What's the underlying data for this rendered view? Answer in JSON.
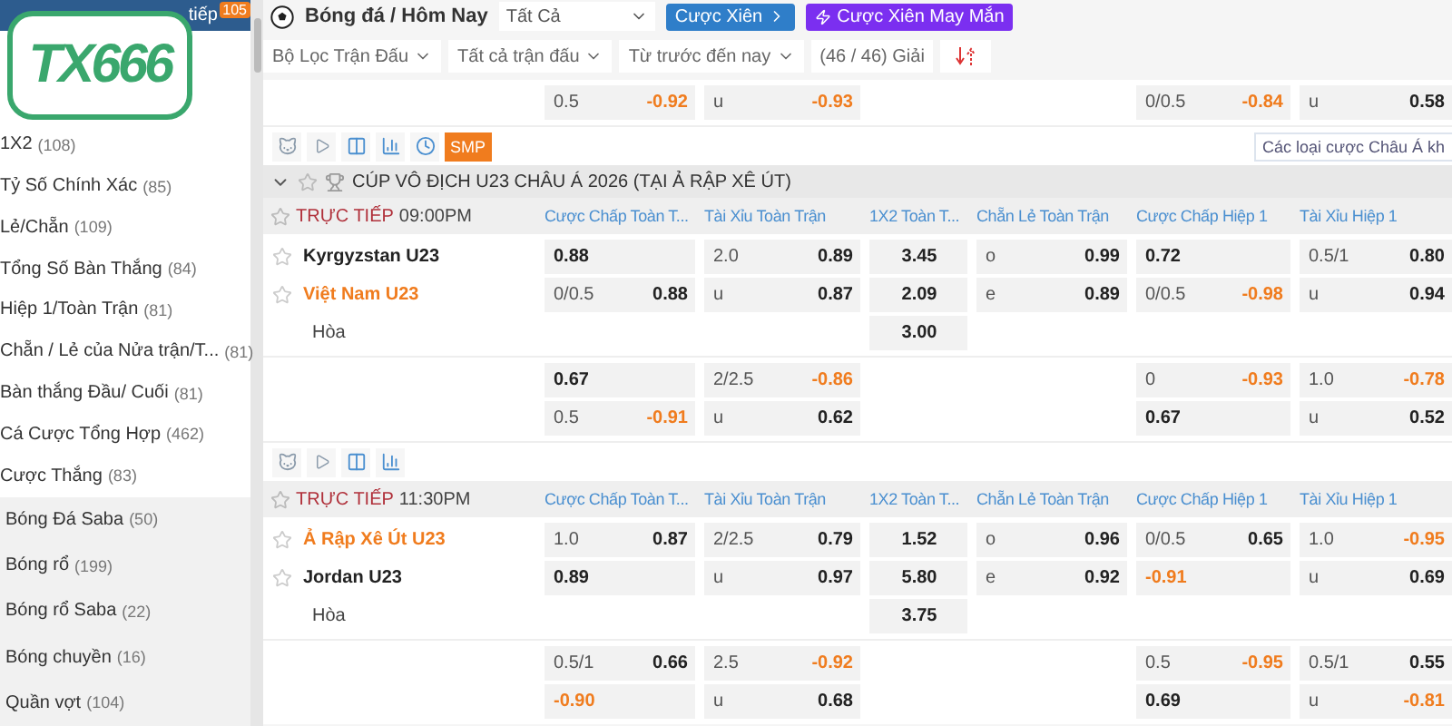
{
  "sidebar": {
    "header": "tiếp",
    "badge": "105",
    "logo": "TX666",
    "items": [
      {
        "label": "1X2",
        "count": "(108)"
      },
      {
        "label": "Tỷ Số Chính Xác",
        "count": "(85)"
      },
      {
        "label": "Lẻ/Chẵn",
        "count": "(109)"
      },
      {
        "label": "Tổng Số Bàn Thắng",
        "count": "(84)"
      },
      {
        "label": "Hiệp 1/Toàn Trận",
        "count": "(81)"
      },
      {
        "label": "Chẵn / Lẻ của Nửa trận/T...",
        "count": "(81)"
      },
      {
        "label": "Bàn thắng Đầu/ Cuối",
        "count": "(81)"
      },
      {
        "label": "Cá Cược Tổng Hợp",
        "count": "(462)"
      },
      {
        "label": "Cược Thắng",
        "count": "(83)"
      }
    ],
    "sports": [
      {
        "label": "Bóng Đá Saba",
        "count": "(50)"
      },
      {
        "label": "Bóng rổ",
        "count": "(199)"
      },
      {
        "label": "Bóng rổ Saba",
        "count": "(22)"
      },
      {
        "label": "Bóng chuyền",
        "count": "(16)"
      },
      {
        "label": "Quần vợt",
        "count": "(104)"
      }
    ]
  },
  "topbar": {
    "title": "Bóng đá / Hôm Nay",
    "select": "Tất Cả",
    "buttons": [
      {
        "label": "Cược Xiên",
        "kind": "parlay"
      },
      {
        "label": "Cược Xiên May Mắn",
        "kind": "lucky"
      }
    ]
  },
  "filters": [
    {
      "label": "Bộ Lọc Trận Đấu",
      "kind": "dropdown"
    },
    {
      "label": "Tất cả trận đấu",
      "kind": "dropdown"
    },
    {
      "label": "Từ trước đến nay",
      "kind": "dropdown"
    },
    {
      "label": "(46 / 46) Giải",
      "kind": "plain"
    }
  ],
  "previous_row": {
    "handicap": {
      "line": "0.5",
      "odds": "-0.92",
      "down": true
    },
    "over_under": {
      "line": "u",
      "odds": "-0.93",
      "down": true
    },
    "half_handicap": {
      "line": "0/0.5",
      "odds": "-0.84",
      "down": true
    },
    "half_over_under": {
      "line": "u",
      "odds": "0.58",
      "down": false
    }
  },
  "toolbar": {
    "button": "SMP",
    "market_select": "Các loại cược Châu Á kh"
  },
  "league": {
    "name": "CÚP VÔ ĐỊCH U23 CHÂU Á 2026 (TẠI Ả RẬP XÊ ÚT)"
  },
  "matches": [
    {
      "status": "TRỰC TIẾP",
      "time": "09:00PM",
      "columns": [
        "Cược Chấp Toàn T...",
        "Tài Xỉu Toàn Trận",
        "1X2 Toàn T...",
        "Chẵn Lẻ Toàn Trận",
        "Cược Chấp Hiệp 1",
        "Tài Xỉu Hiệp 1"
      ],
      "teams": [
        {
          "name": "Kyrgyzstan U23",
          "highlighted": false
        },
        {
          "name": "Việt Nam U23",
          "highlighted": true
        }
      ],
      "draw": "Hòa",
      "main_rows": [
        {
          "handicap": {
            "odds": "0.88",
            "down": false
          },
          "over_under": {
            "line": "2.0",
            "odds": "0.89",
            "down": false
          },
          "result": {
            "odds": "3.45",
            "down": false
          },
          "odd_even": {
            "line": "o",
            "odds": "0.99",
            "down": false
          },
          "half_handicap": {
            "odds": "0.72",
            "down": false
          },
          "half_over_under": {
            "line": "0.5/1",
            "odds": "0.80",
            "down": false
          }
        },
        {
          "handicap": {
            "line": "0/0.5",
            "odds": "0.88",
            "down": false
          },
          "over_under": {
            "line": "u",
            "odds": "0.87",
            "down": false
          },
          "result": {
            "odds": "2.09",
            "down": false
          },
          "odd_even": {
            "line": "e",
            "odds": "0.89",
            "down": false
          },
          "half_handicap": {
            "line": "0/0.5",
            "odds": "-0.98",
            "down": true
          },
          "half_over_under": {
            "line": "u",
            "odds": "0.94",
            "down": false
          }
        },
        {
          "result": {
            "odds": "3.00",
            "down": false
          }
        }
      ],
      "extra_rows": [
        {
          "handicap": {
            "odds": "0.67",
            "down": false
          },
          "over_under": {
            "line": "2/2.5",
            "odds": "-0.86",
            "down": true
          },
          "half_handicap": {
            "line": "0",
            "odds": "-0.93",
            "down": true
          },
          "half_over_under": {
            "line": "1.0",
            "odds": "-0.78",
            "down": true
          }
        },
        {
          "handicap": {
            "line": "0.5",
            "odds": "-0.91",
            "down": true
          },
          "over_under": {
            "line": "u",
            "odds": "0.62",
            "down": false
          },
          "half_handicap": {
            "odds": "0.67",
            "down": false
          },
          "half_over_under": {
            "line": "u",
            "odds": "0.52",
            "down": false
          }
        }
      ]
    },
    {
      "status": "TRỰC TIẾP",
      "time": "11:30PM",
      "columns": [
        "Cược Chấp Toàn T...",
        "Tài Xỉu Toàn Trận",
        "1X2 Toàn T...",
        "Chẵn Lẻ Toàn Trận",
        "Cược Chấp Hiệp 1",
        "Tài Xỉu Hiệp 1"
      ],
      "teams": [
        {
          "name": "Ả Rập Xê Út U23",
          "highlighted": true
        },
        {
          "name": "Jordan U23",
          "highlighted": false
        }
      ],
      "draw": "Hòa",
      "main_rows": [
        {
          "handicap": {
            "line": "1.0",
            "odds": "0.87",
            "down": false
          },
          "over_under": {
            "line": "2/2.5",
            "odds": "0.79",
            "down": false
          },
          "result": {
            "odds": "1.52",
            "down": false
          },
          "odd_even": {
            "line": "o",
            "odds": "0.96",
            "down": false
          },
          "half_handicap": {
            "line": "0/0.5",
            "odds": "0.65",
            "down": false
          },
          "half_over_under": {
            "line": "1.0",
            "odds": "-0.95",
            "down": true
          }
        },
        {
          "handicap": {
            "odds": "0.89",
            "down": false
          },
          "over_under": {
            "line": "u",
            "odds": "0.97",
            "down": false
          },
          "result": {
            "odds": "5.80",
            "down": false
          },
          "odd_even": {
            "line": "e",
            "odds": "0.92",
            "down": false
          },
          "half_handicap": {
            "odds": "-0.91",
            "down": true
          },
          "half_over_under": {
            "line": "u",
            "odds": "0.69",
            "down": false
          }
        },
        {
          "result": {
            "odds": "3.75",
            "down": false
          }
        }
      ],
      "extra_rows": [
        {
          "handicap": {
            "line": "0.5/1",
            "odds": "0.66",
            "down": false
          },
          "over_under": {
            "line": "2.5",
            "odds": "-0.92",
            "down": true
          },
          "half_handicap": {
            "line": "0.5",
            "odds": "-0.95",
            "down": true
          },
          "half_over_under": {
            "line": "0.5/1",
            "odds": "0.55",
            "down": false
          }
        },
        {
          "handicap": {
            "odds": "-0.90",
            "down": true
          },
          "over_under": {
            "line": "u",
            "odds": "0.68",
            "down": false
          },
          "half_handicap": {
            "odds": "0.69",
            "down": false
          },
          "half_over_under": {
            "line": "u",
            "odds": "-0.81",
            "down": true
          }
        }
      ]
    }
  ]
}
